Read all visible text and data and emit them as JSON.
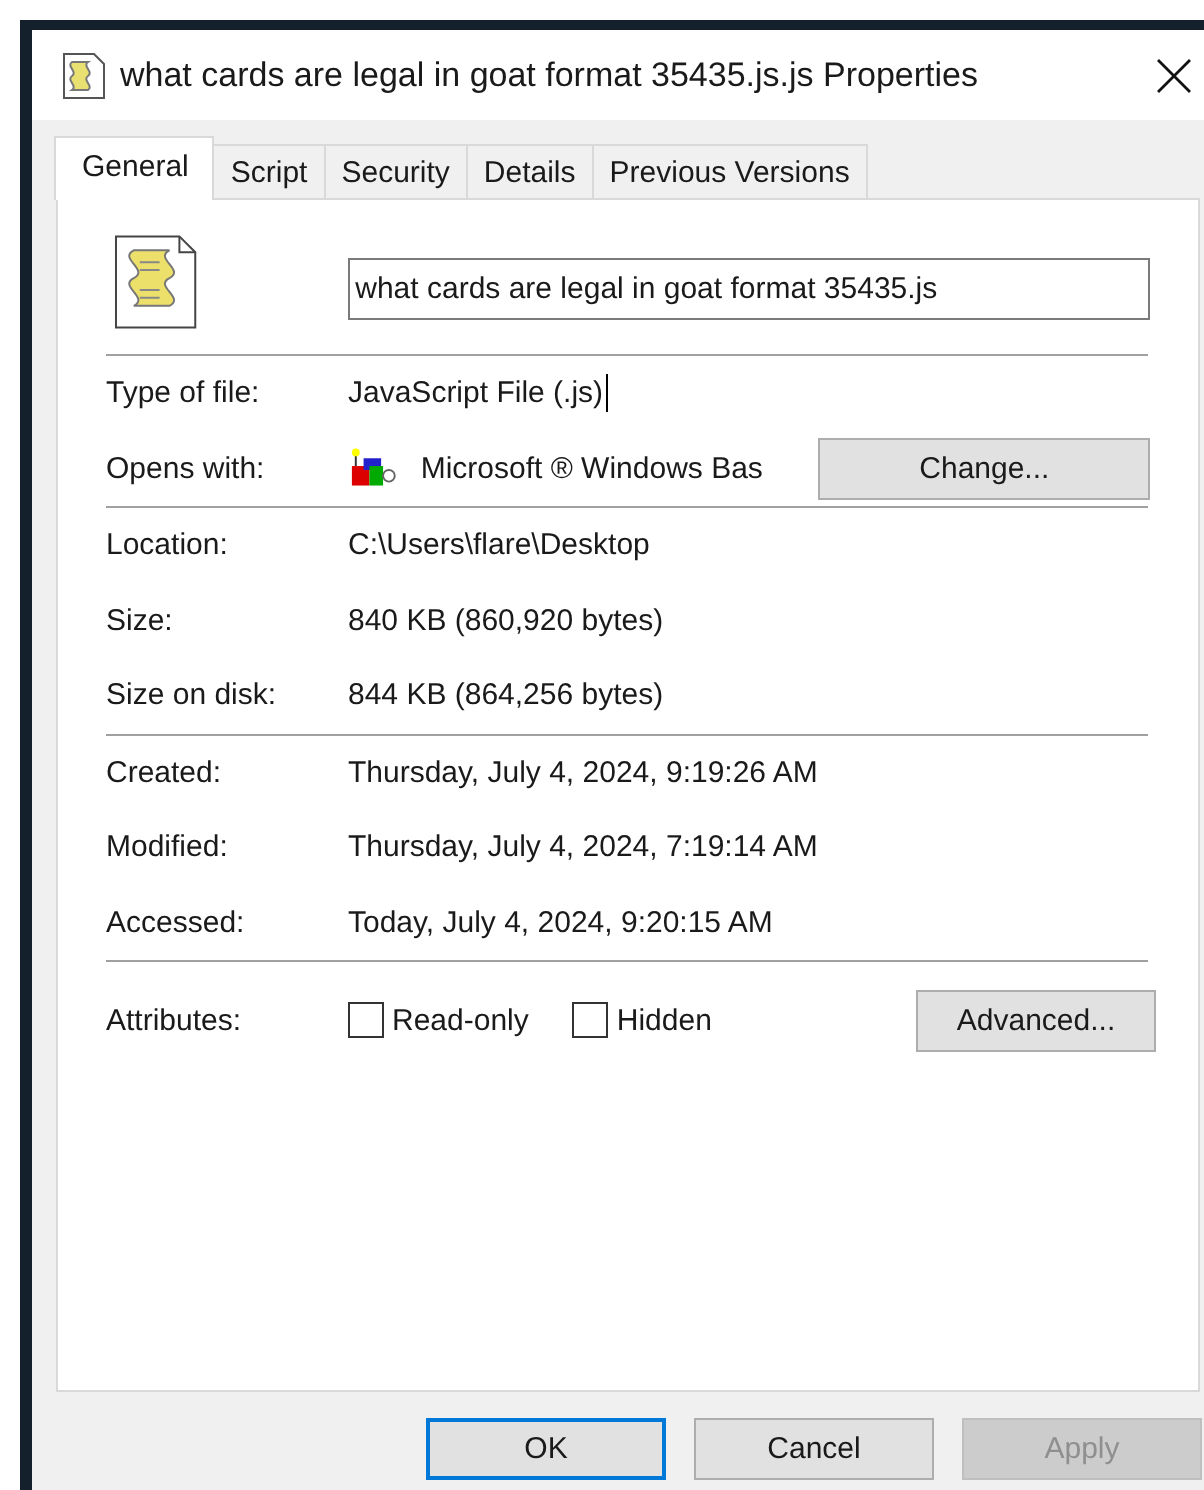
{
  "window": {
    "title": "what cards are legal in goat format 35435.js.js Properties"
  },
  "tabs": [
    {
      "label": "General",
      "selected": true
    },
    {
      "label": "Script",
      "selected": false
    },
    {
      "label": "Security",
      "selected": false
    },
    {
      "label": "Details",
      "selected": false
    },
    {
      "label": "Previous Versions",
      "selected": false
    }
  ],
  "file_name": {
    "value": "what cards are legal in goat format 35435.js"
  },
  "type_of_file": {
    "label": "Type of file:",
    "value": "JavaScript File (.js)"
  },
  "opens_with": {
    "label": "Opens with:",
    "value": "Microsoft ® Windows Bas",
    "button": "Change..."
  },
  "location_rows": [
    {
      "label": "Location:",
      "value": "C:\\Users\\flare\\Desktop"
    },
    {
      "label": "Size:",
      "value": "840 KB (860,920 bytes)"
    },
    {
      "label": "Size on disk:",
      "value": "844 KB (864,256 bytes)"
    }
  ],
  "date_rows": [
    {
      "label": "Created:",
      "value": "Thursday, July 4, 2024, 9:19:26 AM"
    },
    {
      "label": "Modified:",
      "value": "Thursday, July 4, 2024, 7:19:14 AM"
    },
    {
      "label": "Accessed:",
      "value": "Today, July 4, 2024, 9:20:15 AM"
    }
  ],
  "attributes": {
    "label": "Attributes:",
    "checkboxes": [
      {
        "label": "Read-only",
        "checked": false
      },
      {
        "label": "Hidden",
        "checked": false
      }
    ],
    "button": "Advanced..."
  },
  "buttons": [
    {
      "label": "OK",
      "default": true,
      "disabled": false
    },
    {
      "label": "Cancel",
      "default": false,
      "disabled": false
    },
    {
      "label": "Apply",
      "default": false,
      "disabled": true
    }
  ]
}
